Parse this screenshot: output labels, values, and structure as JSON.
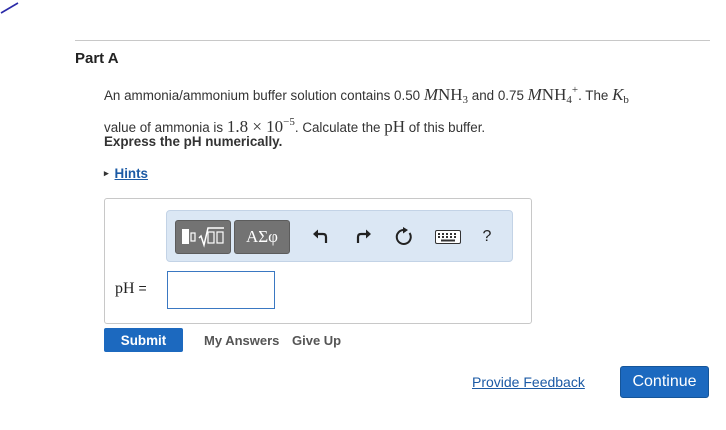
{
  "part": {
    "title": "Part A"
  },
  "question": {
    "t1": "An ammonia/ammonium buffer solution contains 0.50 ",
    "m_conc1": "M",
    "nh3_base": "NH",
    "nh3_sub": "3",
    "t2": " and 0.75 ",
    "m_conc2": "M",
    "nh4_base": "NH",
    "nh4_sub": "4",
    "nh4_sup": "+",
    "t3": ". The ",
    "kb_base": "K",
    "kb_sub": "b",
    "t4": "value of ammonia is ",
    "kb_value_base": "1.8 × 10",
    "kb_value_exp": "−5",
    "t5": ". Calculate the ",
    "ph_term": "pH",
    "t6": " of this buffer."
  },
  "instruction": "Express the pH numerically.",
  "hints": {
    "caret": "▸",
    "label": "Hints"
  },
  "toolbar": {
    "symbols_label": "ΑΣφ",
    "undo_icon": "undo-arrow",
    "redo_icon": "redo-arrow",
    "reset_icon": "reset-circular-arrow",
    "keyboard_icon": "keyboard",
    "help_label": "?"
  },
  "answer": {
    "label_text": "pH",
    "label_eq": " =",
    "value": "",
    "placeholder": ""
  },
  "actions": {
    "submit": "Submit",
    "my_answers": "My Answers",
    "give_up": "Give Up"
  },
  "footer": {
    "feedback": "Provide Feedback",
    "continue": "Continue"
  },
  "colors": {
    "primary_button": "#1c69bf",
    "link": "#1b5aa5",
    "toolbar_bg": "#dbe7f4",
    "toolbar_group": "#737373"
  }
}
